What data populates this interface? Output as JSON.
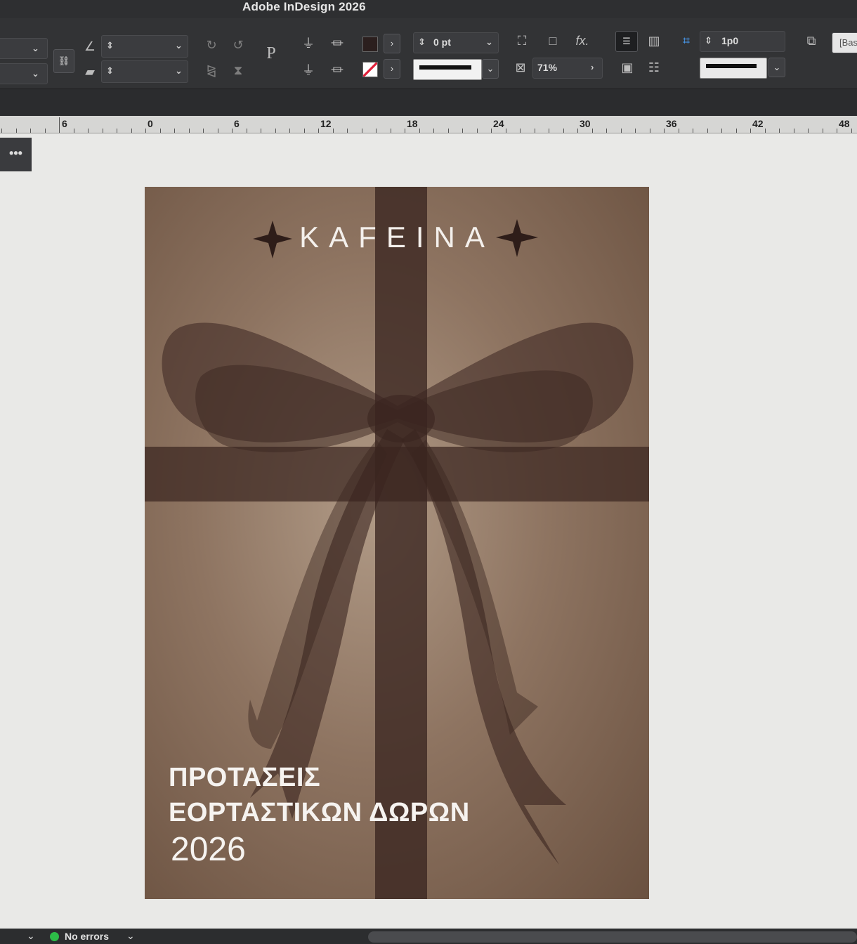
{
  "app": {
    "title": "Adobe InDesign 2026"
  },
  "control_bar": {
    "stroke_weight": "0 pt",
    "opacity": "71%",
    "spacing": "1p0",
    "object_style": "[Bas",
    "fill_color": "#2b1f1e"
  },
  "ruler": {
    "labels": [
      "6",
      "0",
      "6",
      "12",
      "18",
      "24",
      "30",
      "36",
      "42",
      "48"
    ]
  },
  "panel": {
    "menu_label": "•••"
  },
  "document": {
    "brand": "KAFEINA",
    "headline_line1": "ΠΡΟΤΑΣΕΙΣ",
    "headline_line2": "ΕΟΡΤΑΣΤΙΚΩΝ ΔΩΡΩΝ",
    "year": "2026",
    "colors": {
      "background": "#8e7461",
      "ribbon": "#3a2520",
      "text": "#f6f3f0"
    }
  },
  "status": {
    "preflight": "No errors"
  }
}
